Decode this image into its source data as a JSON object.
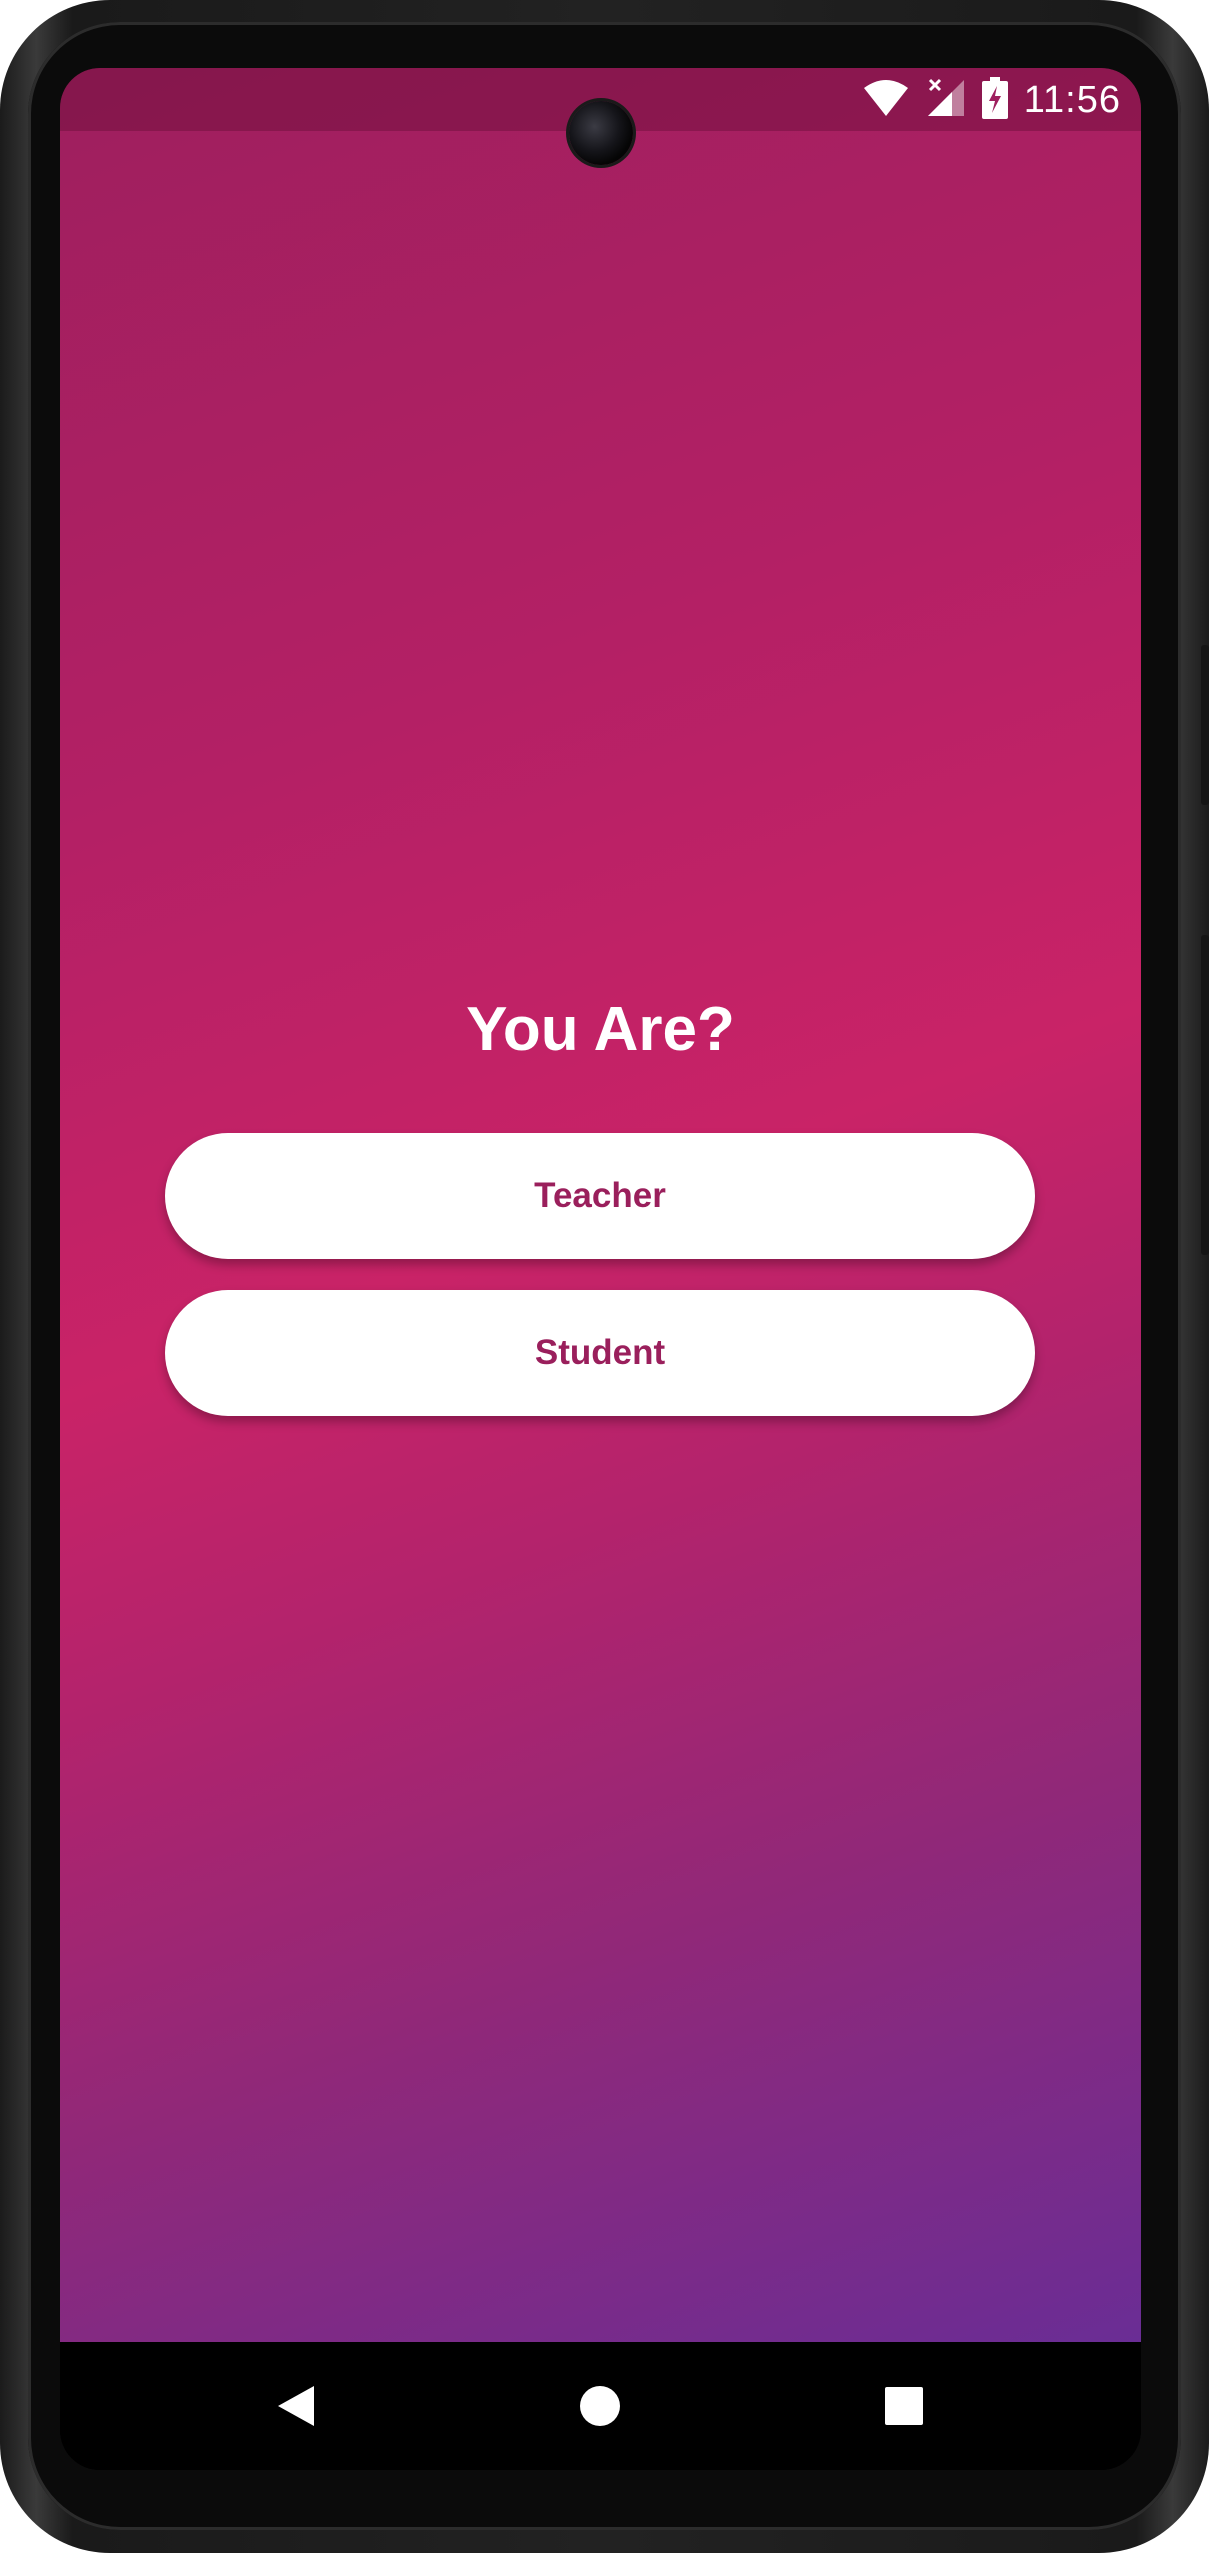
{
  "status_bar": {
    "time": "11:56",
    "icons": [
      "wifi-icon",
      "signal-icon",
      "battery-charging-icon"
    ]
  },
  "main": {
    "title": "You Are?",
    "buttons": [
      {
        "label": "Teacher"
      },
      {
        "label": "Student"
      }
    ]
  },
  "nav_bar": {
    "icons": [
      "back-icon",
      "home-icon",
      "recents-icon"
    ]
  },
  "colors": {
    "gradient_top": "#9e1f5e",
    "gradient_mid": "#c92367",
    "gradient_bottom": "#6a2d95",
    "button_text": "#9a1f5c",
    "button_bg": "#ffffff"
  }
}
